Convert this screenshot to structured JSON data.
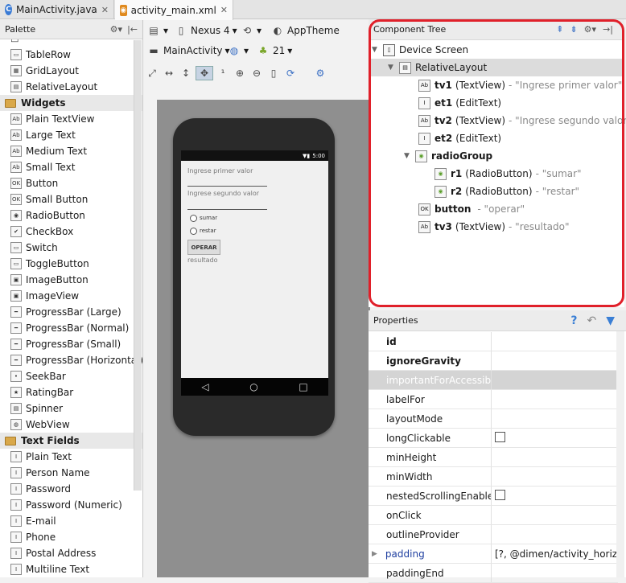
{
  "tabs": [
    {
      "label": "MainActivity.java",
      "icon": "java-class-icon"
    },
    {
      "label": "activity_main.xml",
      "icon": "xml-layout-icon"
    }
  ],
  "palette": {
    "title": "Palette",
    "items_top": [
      "TableRow",
      "GridLayout",
      "RelativeLayout"
    ],
    "widgets_label": "Widgets",
    "widgets": [
      "Plain TextView",
      "Large Text",
      "Medium Text",
      "Small Text",
      "Button",
      "Small Button",
      "RadioButton",
      "CheckBox",
      "Switch",
      "ToggleButton",
      "ImageButton",
      "ImageView",
      "ProgressBar (Large)",
      "ProgressBar (Normal)",
      "ProgressBar (Small)",
      "ProgressBar (Horizontal)",
      "SeekBar",
      "RatingBar",
      "Spinner",
      "WebView"
    ],
    "textfields_label": "Text Fields",
    "textfields": [
      "Plain Text",
      "Person Name",
      "Password",
      "Password (Numeric)",
      "E-mail",
      "Phone",
      "Postal Address",
      "Multiline Text"
    ]
  },
  "toolbar": {
    "device": "Nexus 4",
    "theme": "AppTheme",
    "activity": "MainActivity",
    "api": "21"
  },
  "phone": {
    "time": "5:00",
    "hint1": "Ingrese primer valor",
    "hint2": "Ingrese segundo valor",
    "radio1": "sumar",
    "radio2": "restar",
    "button": "OPERAR",
    "result": "resultado"
  },
  "component_tree": {
    "title": "Component Tree",
    "root": "Device Screen",
    "layout": "RelativeLayout",
    "nodes": [
      {
        "name": "tv1",
        "type": "(TextView)",
        "desc": "- \"Ingrese primer valor\""
      },
      {
        "name": "et1",
        "type": "(EditText)",
        "desc": ""
      },
      {
        "name": "tv2",
        "type": "(TextView)",
        "desc": "- \"Ingrese segundo valor\""
      },
      {
        "name": "et2",
        "type": "(EditText)",
        "desc": ""
      },
      {
        "name": "radioGroup",
        "type": "",
        "desc": ""
      },
      {
        "name": "r1",
        "type": "(RadioButton)",
        "desc": "- \"sumar\""
      },
      {
        "name": "r2",
        "type": "(RadioButton)",
        "desc": "- \"restar\""
      },
      {
        "name": "button",
        "type": "",
        "desc": "- \"operar\""
      },
      {
        "name": "tv3",
        "type": "(TextView)",
        "desc": "- \"resultado\""
      }
    ]
  },
  "properties": {
    "title": "Properties",
    "rows": [
      {
        "name": "id",
        "value": ""
      },
      {
        "name": "ignoreGravity",
        "value": ""
      },
      {
        "name": "importantForAccessibility",
        "value": ""
      },
      {
        "name": "labelFor",
        "value": ""
      },
      {
        "name": "layoutMode",
        "value": ""
      },
      {
        "name": "longClickable",
        "value": ""
      },
      {
        "name": "minHeight",
        "value": ""
      },
      {
        "name": "minWidth",
        "value": ""
      },
      {
        "name": "nestedScrollingEnabled",
        "value": ""
      },
      {
        "name": "onClick",
        "value": ""
      },
      {
        "name": "outlineProvider",
        "value": ""
      },
      {
        "name": "padding",
        "value": "[?, @dimen/activity_horizon"
      },
      {
        "name": "paddingEnd",
        "value": ""
      }
    ]
  }
}
